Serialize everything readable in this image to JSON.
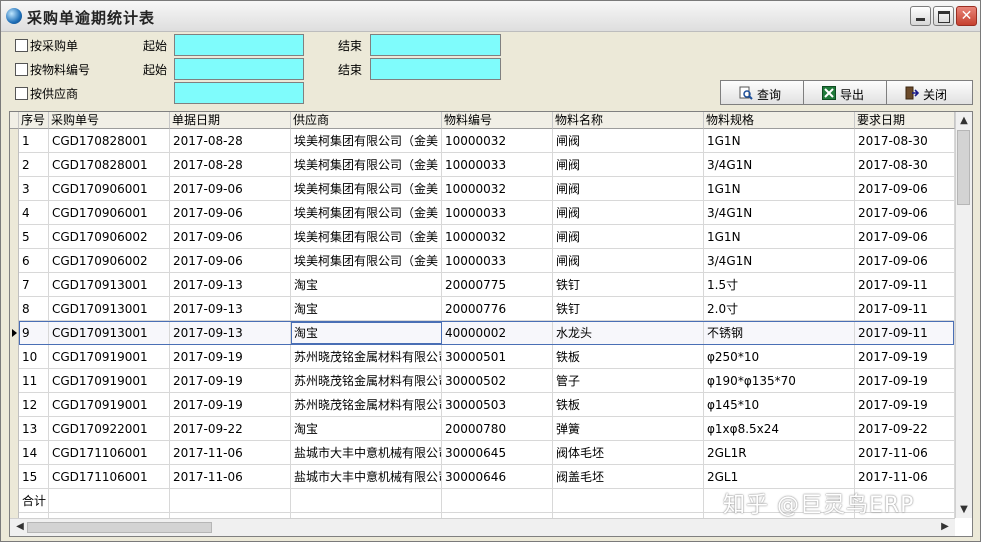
{
  "window": {
    "title": "采购单逾期统计表",
    "controls": {
      "minimize": "_",
      "maximize": "□",
      "close": "✕"
    }
  },
  "filters": {
    "by_po": "按采购单",
    "by_material": "按物料编号",
    "by_supplier": "按供应商",
    "start_label": "起始",
    "end_label": "结束",
    "po_start": "",
    "po_end": "",
    "material_start": "",
    "material_end": "",
    "supplier": ""
  },
  "toolbar": {
    "query": "查询",
    "export": "导出",
    "close": "关闭"
  },
  "table": {
    "columns": [
      "序号",
      "采购单号",
      "单据日期",
      "供应商",
      "物料编号",
      "物料名称",
      "物料规格",
      "要求日期"
    ],
    "rows": [
      [
        "1",
        "CGD170828001",
        "2017-08-28",
        "埃美柯集团有限公司（金美",
        "10000032",
        "闸阀",
        "1G1N",
        "2017-08-30"
      ],
      [
        "2",
        "CGD170828001",
        "2017-08-28",
        "埃美柯集团有限公司（金美",
        "10000033",
        "闸阀",
        "3/4G1N",
        "2017-08-30"
      ],
      [
        "3",
        "CGD170906001",
        "2017-09-06",
        "埃美柯集团有限公司（金美",
        "10000032",
        "闸阀",
        "1G1N",
        "2017-09-06"
      ],
      [
        "4",
        "CGD170906001",
        "2017-09-06",
        "埃美柯集团有限公司（金美",
        "10000033",
        "闸阀",
        "3/4G1N",
        "2017-09-06"
      ],
      [
        "5",
        "CGD170906002",
        "2017-09-06",
        "埃美柯集团有限公司（金美",
        "10000032",
        "闸阀",
        "1G1N",
        "2017-09-06"
      ],
      [
        "6",
        "CGD170906002",
        "2017-09-06",
        "埃美柯集团有限公司（金美",
        "10000033",
        "闸阀",
        "3/4G1N",
        "2017-09-06"
      ],
      [
        "7",
        "CGD170913001",
        "2017-09-13",
        "淘宝",
        "20000775",
        "铁钉",
        "1.5寸",
        "2017-09-11"
      ],
      [
        "8",
        "CGD170913001",
        "2017-09-13",
        "淘宝",
        "20000776",
        "铁钉",
        "2.0寸",
        "2017-09-11"
      ],
      [
        "9",
        "CGD170913001",
        "2017-09-13",
        "淘宝",
        "40000002",
        "水龙头",
        "不锈钢",
        "2017-09-11"
      ],
      [
        "10",
        "CGD170919001",
        "2017-09-19",
        "苏州晓茂铭金属材料有限公司",
        "30000501",
        "铁板",
        "φ250*10",
        "2017-09-19"
      ],
      [
        "11",
        "CGD170919001",
        "2017-09-19",
        "苏州晓茂铭金属材料有限公司",
        "30000502",
        "管子",
        "φ190*φ135*70",
        "2017-09-19"
      ],
      [
        "12",
        "CGD170919001",
        "2017-09-19",
        "苏州晓茂铭金属材料有限公司",
        "30000503",
        "铁板",
        "φ145*10",
        "2017-09-19"
      ],
      [
        "13",
        "CGD170922001",
        "2017-09-22",
        "淘宝",
        "20000780",
        "弹簧",
        "φ1xφ8.5x24",
        "2017-09-22"
      ],
      [
        "14",
        "CGD171106001",
        "2017-11-06",
        "盐城市大丰中意机械有限公司",
        "30000645",
        "阀体毛坯",
        "2GL1R",
        "2017-11-06"
      ],
      [
        "15",
        "CGD171106001",
        "2017-11-06",
        "盐城市大丰中意机械有限公司",
        "30000646",
        "阀盖毛坯",
        "2GL1",
        "2017-11-06"
      ]
    ],
    "selected_row": 9,
    "total_label": "合计"
  },
  "watermark": "知乎 @巨灵鸟ERP"
}
